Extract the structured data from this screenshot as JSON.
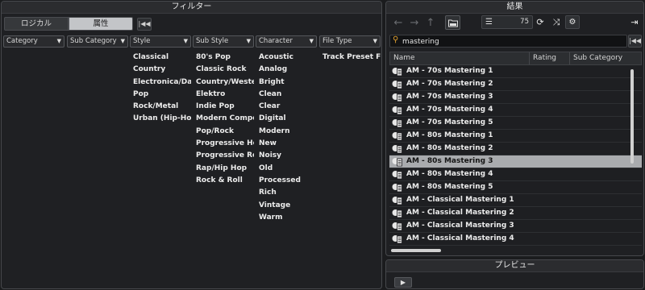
{
  "filter": {
    "title": "フィルター",
    "tabs": {
      "logical": "ロジカル",
      "attribute": "属性"
    },
    "reset_icon": "skip-back-icon",
    "columns": [
      {
        "header": "Category",
        "items": []
      },
      {
        "header": "Sub Category",
        "items": []
      },
      {
        "header": "Style",
        "items": [
          "Classical",
          "Country",
          "Electronica/Danc",
          "Pop",
          "Rock/Metal",
          "Urban (Hip-Hop /"
        ]
      },
      {
        "header": "Sub Style",
        "items": [
          "80's Pop",
          "Classic Rock",
          "Country/Western",
          "Elektro",
          "Indie Pop",
          "Modern Composi",
          "Pop/Rock",
          "Progressive Hous",
          "Progressive Rock",
          "Rap/Hip Hop",
          "Rock & Roll"
        ]
      },
      {
        "header": "Character",
        "items": [
          "Acoustic",
          "Analog",
          "Bright",
          "Clean",
          "Clear",
          "Digital",
          "Modern",
          "New",
          "Noisy",
          "Old",
          "Processed",
          "Rich",
          "Vintage",
          "Warm"
        ]
      },
      {
        "header": "File Type",
        "items": [
          "Track Preset File"
        ]
      }
    ]
  },
  "results": {
    "title": "結果",
    "count": "75",
    "search": {
      "value": "mastering",
      "placeholder": ""
    },
    "headers": {
      "name": "Name",
      "rating": "Rating",
      "sub_category": "Sub Category"
    },
    "rows": [
      "AM - 70s Mastering 1",
      "AM - 70s Mastering 2",
      "AM - 70s Mastering 3",
      "AM - 70s Mastering 4",
      "AM - 70s Mastering 5",
      "AM - 80s Mastering 1",
      "AM - 80s Mastering 2",
      "AM - 80s Mastering 3",
      "AM - 80s Mastering 4",
      "AM - 80s Mastering 5",
      "AM - Classical Mastering 1",
      "AM - Classical Mastering 2",
      "AM - Classical Mastering 3",
      "AM - Classical Mastering 4"
    ],
    "selected_index": 7
  },
  "preview": {
    "title": "プレビュー"
  },
  "colors": {
    "selection": "#a9abae",
    "search_icon": "#e0a030",
    "panel_bg": "#1f2023"
  }
}
